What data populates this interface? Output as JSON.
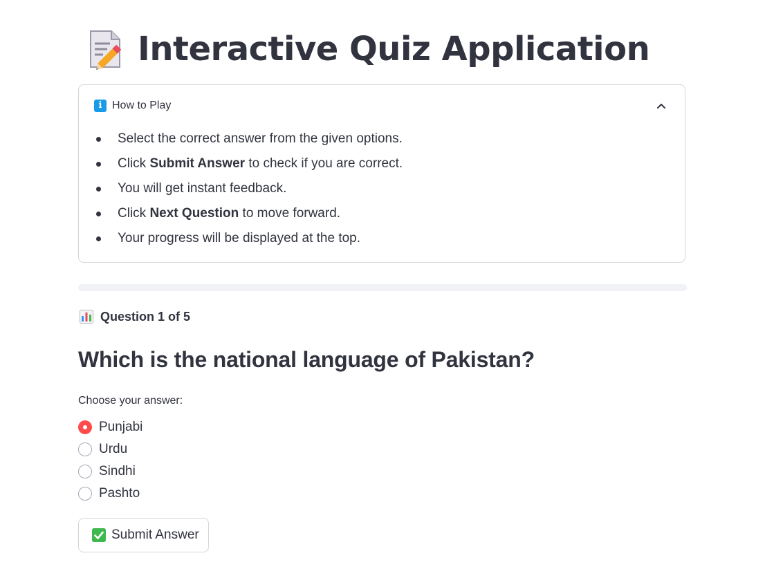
{
  "header": {
    "title": "Interactive Quiz Application",
    "title_icon": "memo-icon"
  },
  "how_to_play": {
    "label": "How to Play",
    "icon": "info-icon",
    "expanded": true,
    "rules": [
      {
        "pre": "Select the correct answer from the given options.",
        "bold": "",
        "post": ""
      },
      {
        "pre": "Click ",
        "bold": "Submit Answer",
        "post": " to check if you are correct."
      },
      {
        "pre": "You will get instant feedback.",
        "bold": "",
        "post": ""
      },
      {
        "pre": "Click ",
        "bold": "Next Question",
        "post": " to move forward."
      },
      {
        "pre": "Your progress will be displayed at the top.",
        "bold": "",
        "post": ""
      }
    ]
  },
  "progress": {
    "fraction": 0.0
  },
  "counter": {
    "icon": "bar-chart-icon",
    "text": "Question 1 of 5"
  },
  "question": {
    "text": "Which is the national language of Pakistan?",
    "prompt": "Choose your answer:",
    "options": [
      "Punjabi",
      "Urdu",
      "Sindhi",
      "Pashto"
    ],
    "selected_index": 0
  },
  "submit": {
    "label": "Submit Answer",
    "icon": "check-mark-icon"
  },
  "colors": {
    "accent": "#ff4b4b",
    "text": "#31333f",
    "info": "#1a9be8",
    "check": "#3fb94f"
  }
}
